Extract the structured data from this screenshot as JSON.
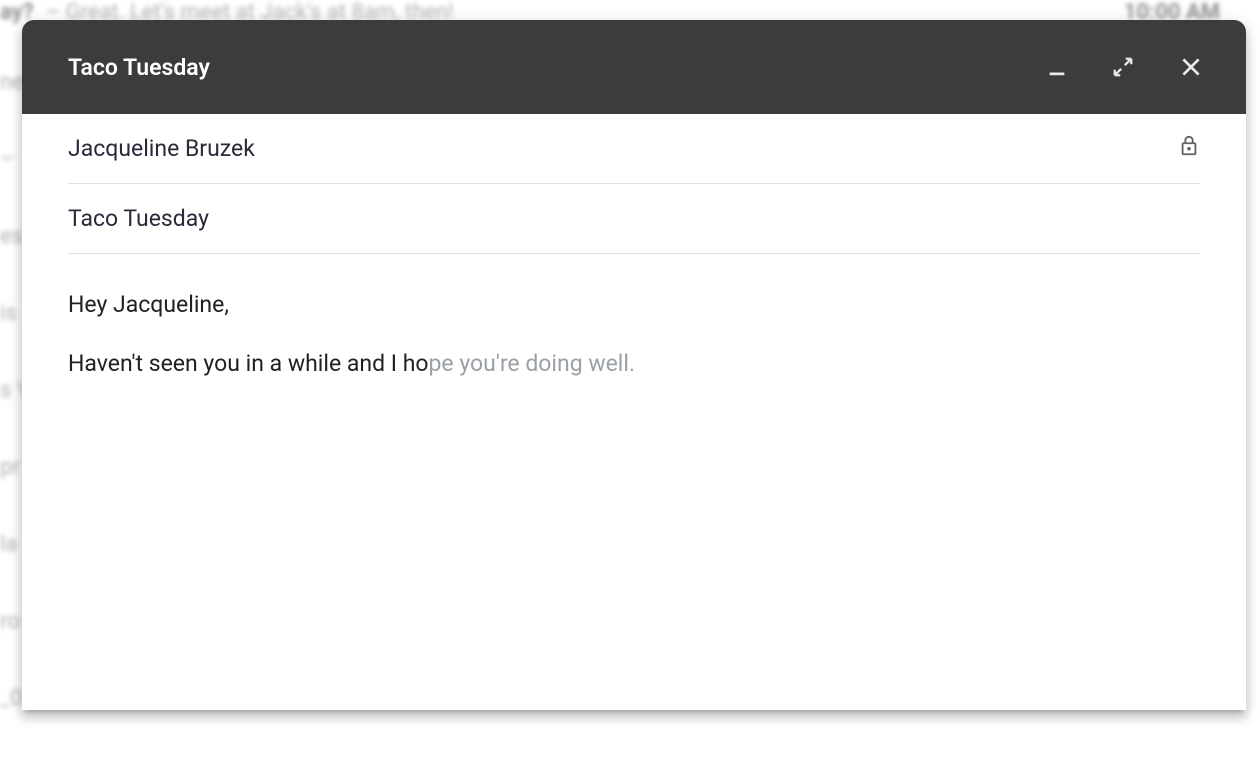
{
  "background": {
    "top_row": {
      "subject_fragment": "ay?",
      "snippet": "Great. Let's meet at Jack's at 8am, then!",
      "time": "10:00 AM"
    },
    "left_fragments": [
      "ne",
      "–",
      "es",
      "is",
      "s \\",
      "pr",
      "la",
      "ro",
      "_0"
    ]
  },
  "compose": {
    "title": "Taco Tuesday",
    "to": "Jacqueline Bruzek",
    "subject": "Taco Tuesday",
    "body_greeting": "Hey Jacqueline,",
    "body_typed": "Haven't seen you in a while and I ho",
    "body_suggested": "pe you're doing well."
  }
}
